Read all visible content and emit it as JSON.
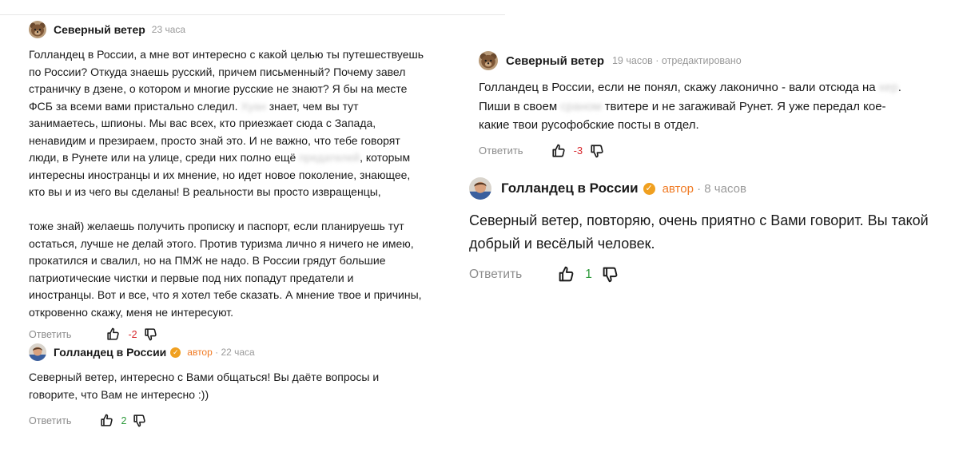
{
  "colors": {
    "author_badge": "#f07a23",
    "downvote_count": "#d7262b",
    "upvote_count": "#2c9a3a",
    "meta": "#9a9a9a"
  },
  "comments": [
    {
      "author": "Северный ветер",
      "time": "23 часа",
      "avatar_icon": "bear-avatar-icon",
      "body_parts": [
        "Голландец в России, а мне вот интересно с какой целью ты путешествуешь\nпо России? Откуда знаешь русский, причем письменный? Почему завел\nстраничку в дзене, о котором и многие русские не знают? Я бы на месте\nФСБ за всеми вами пристально следил. ",
        "Хуан",
        " знает, чем вы тут\nзанимаетесь, шпионы. Мы вас всех, кто приезжает сюда с Запада,\nненавидим и презираем, просто знай это. И не важно, что тебе говорят\nлюди, в Рунете или на улице, среди них полно ещё ",
        "предателей",
        ", которым\nинтересны иностранцы и их мнение, но идет новое поколение, знающее,\nкто вы и из чего вы сделаны! В реальности вы просто извращенцы,\n\nтоже знай) желаешь получить прописку и паспорт, если планируешь тут\nостаться, лучше не делай этого. Против туризма лично я ничего не имею,\nпрокатился и свалил, но на ПМЖ не надо. В России грядут большие\nпатриотические чистки и первые под них попадут предатели и\nиностранцы. Вот и все, что я хотел тебе сказать. А мнение твое и причины,\nоткровенно скажу, меня не интересуют."
      ],
      "reply_label": "Ответить",
      "rating": "-2"
    },
    {
      "author": "Голландец в России",
      "verified_icon": "verified-check-icon",
      "author_badge": "автор",
      "time": "22 часа",
      "avatar_icon": "user-photo-avatar-icon",
      "body": "Северный ветер, интересно с Вами общаться! Вы даёте вопросы и\nговорите, что Вам не интересно :))",
      "reply_label": "Ответить",
      "rating": "2"
    },
    {
      "author": "Северный ветер",
      "time": "19 часов",
      "edited": "отредактировано",
      "avatar_icon": "bear-avatar-icon",
      "body_parts": [
        "Голландец в России, если не понял, скажу лаконично - вали отсюда на ",
        "хер",
        ".\nПиши в своем ",
        "сраном",
        " твитере и не загаживай Рунет. Я уже передал кое-\nкакие твои русофобские посты в отдел."
      ],
      "reply_label": "Ответить",
      "rating": "-3"
    },
    {
      "author": "Голландец в России",
      "verified_icon": "verified-check-icon",
      "author_badge": "автор",
      "time": "8 часов",
      "avatar_icon": "user-photo-avatar-icon",
      "body": "Северный ветер, повторяю, очень приятно с Вами говорит. Вы такой\nдобрый и весёлый человек.",
      "reply_label": "Ответить",
      "rating": "1"
    }
  ]
}
